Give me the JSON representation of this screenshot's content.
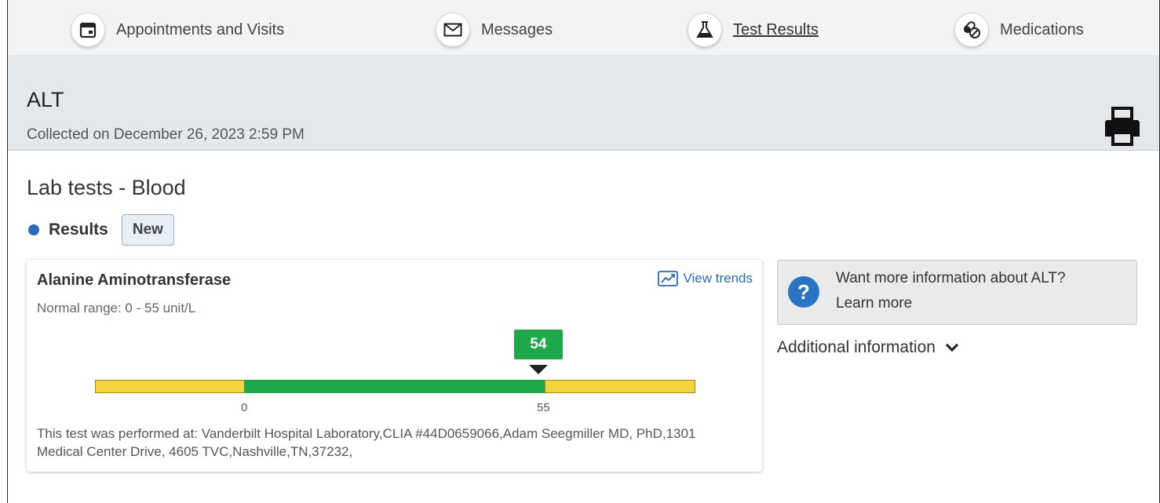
{
  "nav": {
    "items": [
      {
        "label": "Appointments and Visits",
        "icon": "calendar-icon"
      },
      {
        "label": "Messages",
        "icon": "envelope-icon"
      },
      {
        "label": "Test Results",
        "icon": "flask-icon",
        "active": true
      },
      {
        "label": "Medications",
        "icon": "pills-icon"
      }
    ]
  },
  "header": {
    "title": "ALT",
    "collected": "Collected on December 26, 2023 2:59 PM",
    "print_icon": "printer-icon"
  },
  "section": {
    "title": "Lab tests - Blood",
    "results_label": "Results",
    "badge": "New"
  },
  "result": {
    "name": "Alanine Aminotransferase",
    "range_text": "Normal range: 0 - 55 unit/L",
    "view_trends": "View trends",
    "value": "54",
    "value_fraction_of_scale": 0.7059,
    "tick_low": "0",
    "tick_high": "55",
    "performed_at": "This test was performed at: Vanderbilt Hospital Laboratory,CLIA #44D0659066,Adam Seegmiller MD, PhD,1301 Medical Center Drive, 4605 TVC,Nashville,TN,37232,"
  },
  "info": {
    "question": "Want more information about ALT?",
    "link": "Learn more",
    "additional": "Additional information"
  },
  "colors": {
    "normal": "#1fa84a",
    "out_of_range": "#f4d43c",
    "accent": "#2a6ab8",
    "header_band": "#e5e8ea"
  }
}
